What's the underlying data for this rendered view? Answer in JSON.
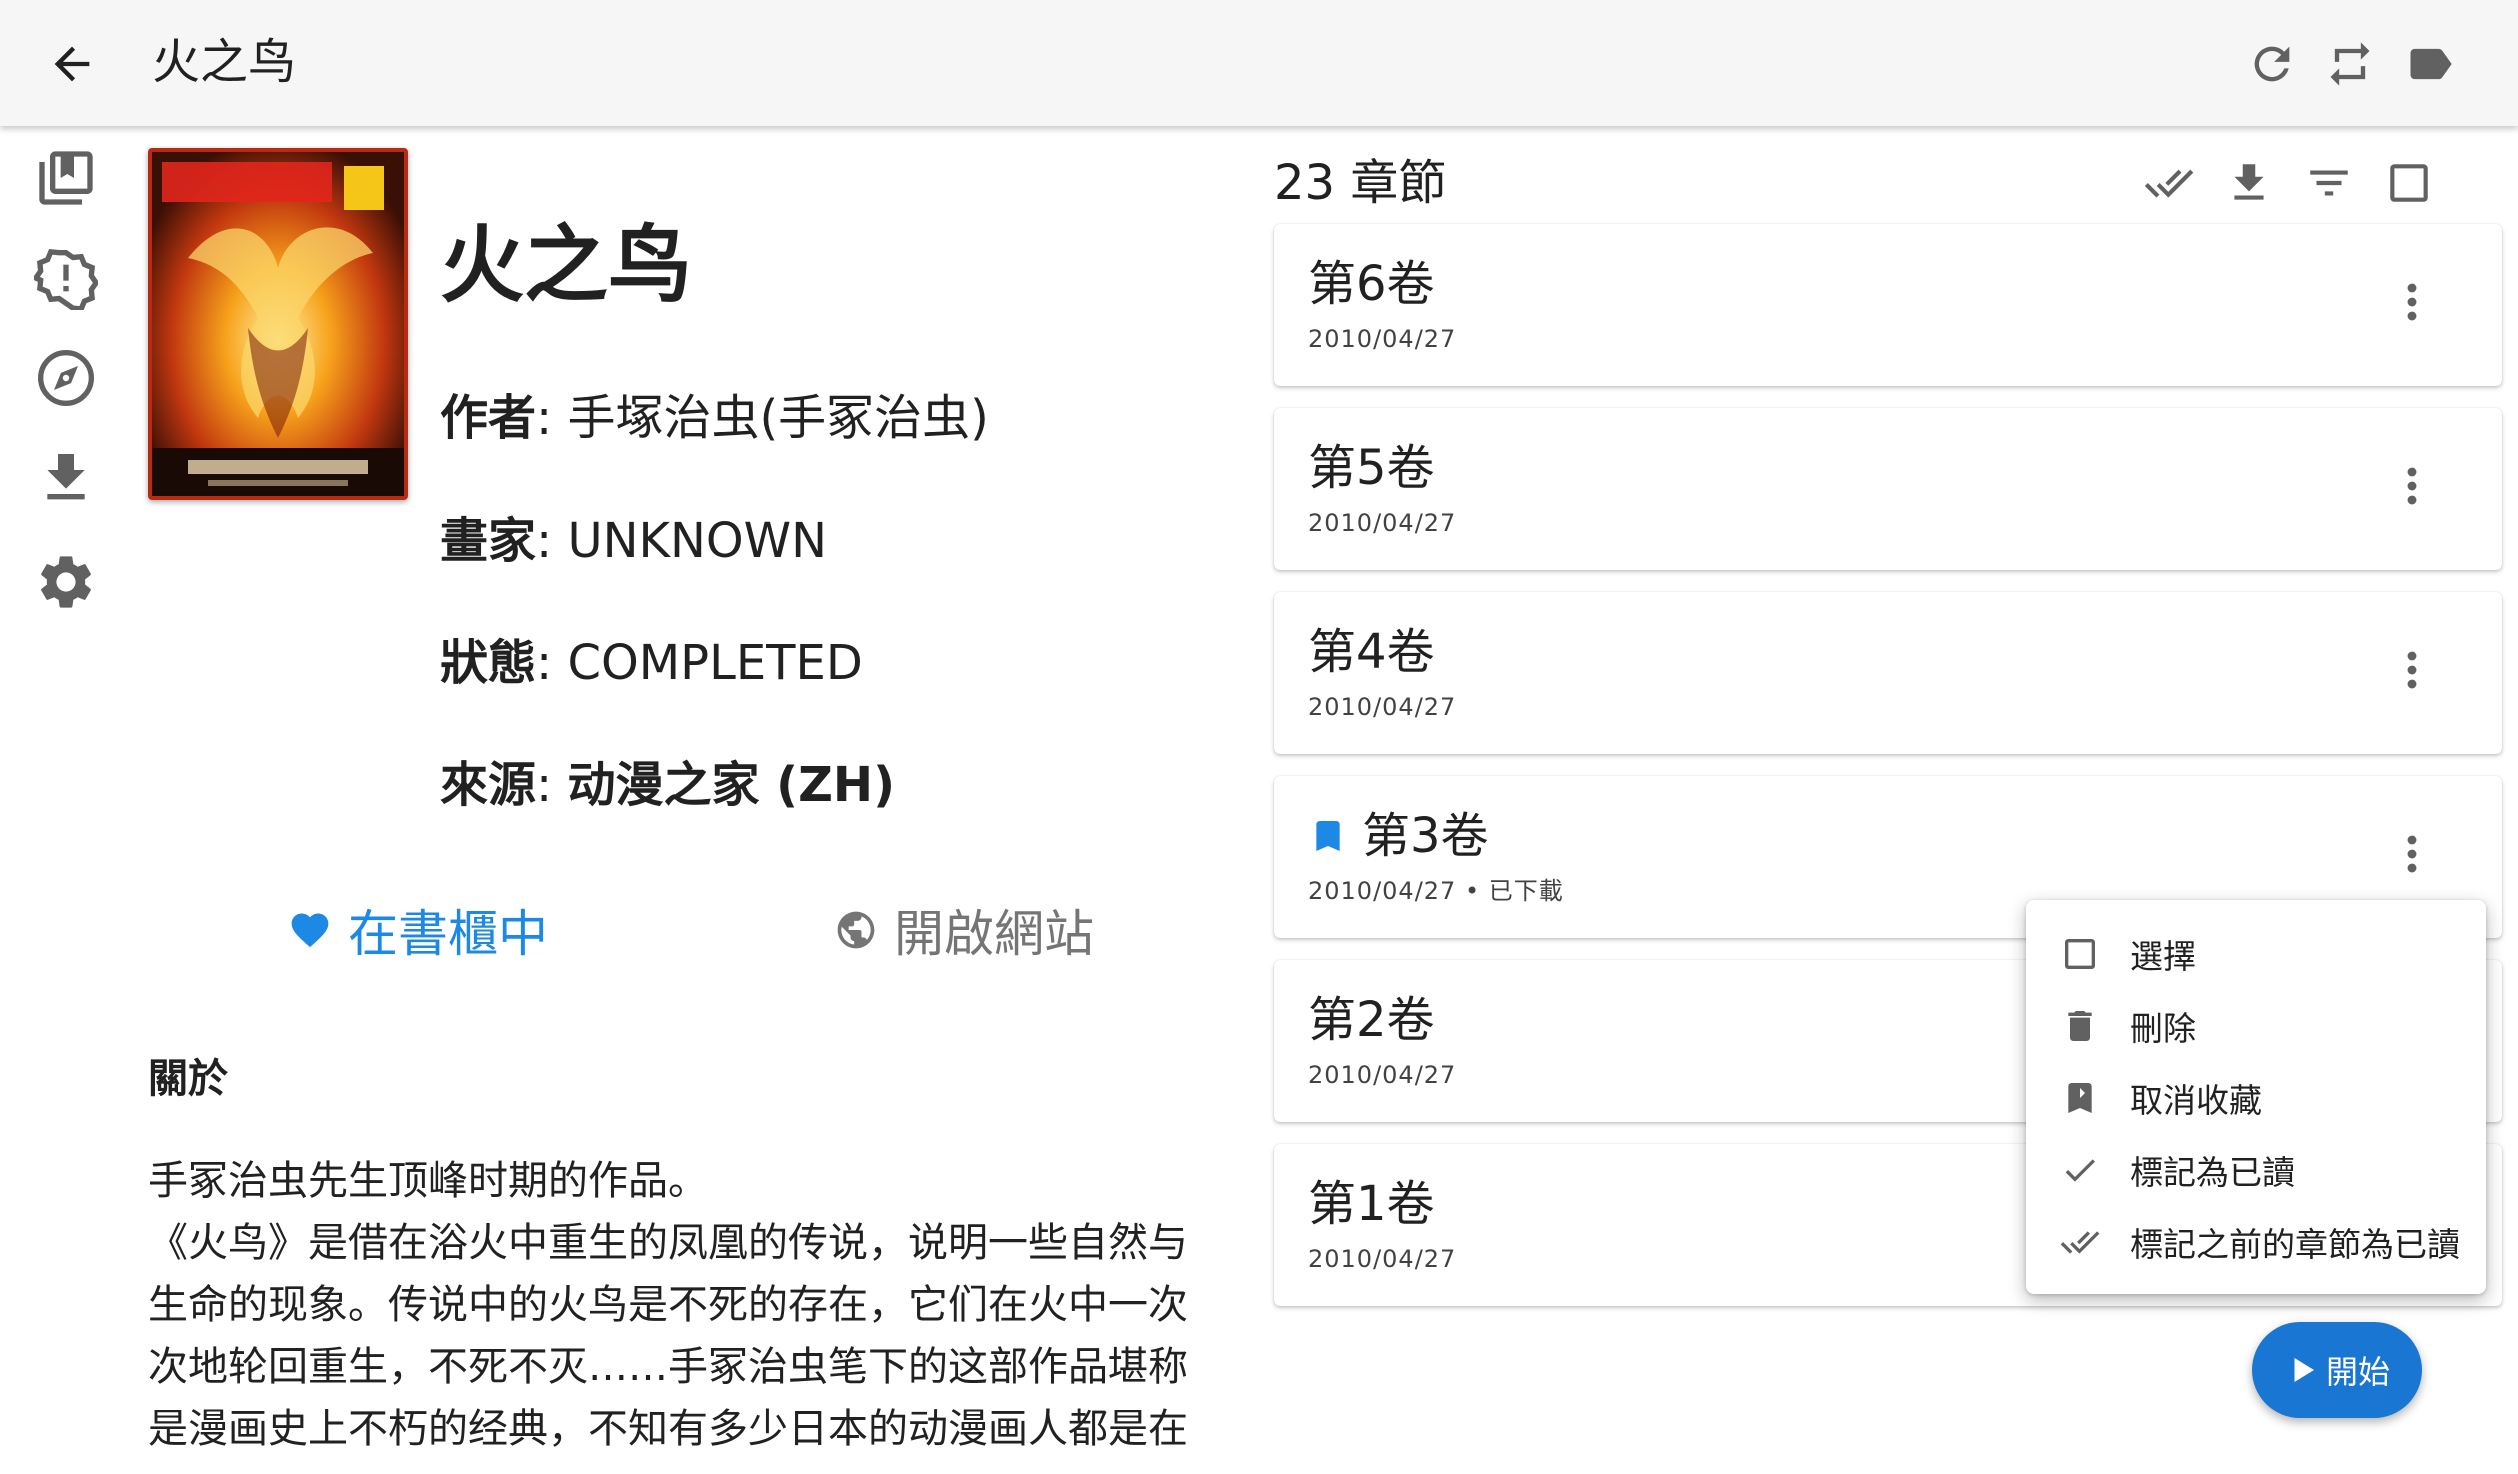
{
  "app": {
    "title": "火之鸟"
  },
  "toolbar": {
    "icons": [
      "back-arrow-icon",
      "refresh-icon",
      "migrate-icon",
      "label-icon"
    ]
  },
  "nav": {
    "icons": [
      "library-icon",
      "updates-icon",
      "browse-icon",
      "downloads-icon",
      "settings-icon"
    ]
  },
  "manga": {
    "title": "火之鸟",
    "author_label": "作者",
    "author": "手塚治虫(手冢治虫)",
    "artist_label": "畫家",
    "artist": "UNKNOWN",
    "status_label": "狀態",
    "status": "COMPLETED",
    "source_label": "來源",
    "source": "动漫之家 (ZH)",
    "in_library_label": "在書櫃中",
    "open_website_label": "開啟網站",
    "about_label": "關於",
    "description_lines": [
      "手冢治虫先生顶峰时期的作品。",
      "《火鸟》是借在浴火中重生的凤凰的传说，说明一些自然与",
      "生命的现象。传说中的火鸟是不死的存在，它们在火中一次",
      "次地轮回重生，不死不灭……手冢治虫笔下的这部作品堪称",
      "是漫画史上不朽的经典，不知有多少日本的动漫画人都是在"
    ]
  },
  "chapters": {
    "count_label": "23 章節",
    "header_icons": [
      "mark-all-read-icon",
      "download-icon",
      "filter-icon",
      "select-all-icon"
    ],
    "items": [
      {
        "name": "第6卷",
        "date": "2010/04/27",
        "bookmarked": false
      },
      {
        "name": "第5卷",
        "date": "2010/04/27",
        "bookmarked": false
      },
      {
        "name": "第4卷",
        "date": "2010/04/27",
        "bookmarked": false
      },
      {
        "name": "第3卷",
        "date": "2010/04/27 • 已下載",
        "bookmarked": true
      },
      {
        "name": "第2卷",
        "date": "2010/04/27",
        "bookmarked": false
      },
      {
        "name": "第1卷",
        "date": "2010/04/27",
        "bookmarked": false
      }
    ]
  },
  "context_menu": {
    "items": [
      {
        "label": "選擇",
        "icon": "checkbox-outline-icon"
      },
      {
        "label": "刪除",
        "icon": "trash-icon"
      },
      {
        "label": "取消收藏",
        "icon": "bookmark-remove-icon"
      },
      {
        "label": "標記為已讀",
        "icon": "check-icon"
      },
      {
        "label": "標記之前的章節為已讀",
        "icon": "double-check-icon"
      }
    ]
  },
  "fab": {
    "label": "開始"
  },
  "colors": {
    "accent": "#1e88e5",
    "fab": "#1976d2",
    "appbar": "#f6f6f6",
    "icon_gray": "#616161"
  }
}
